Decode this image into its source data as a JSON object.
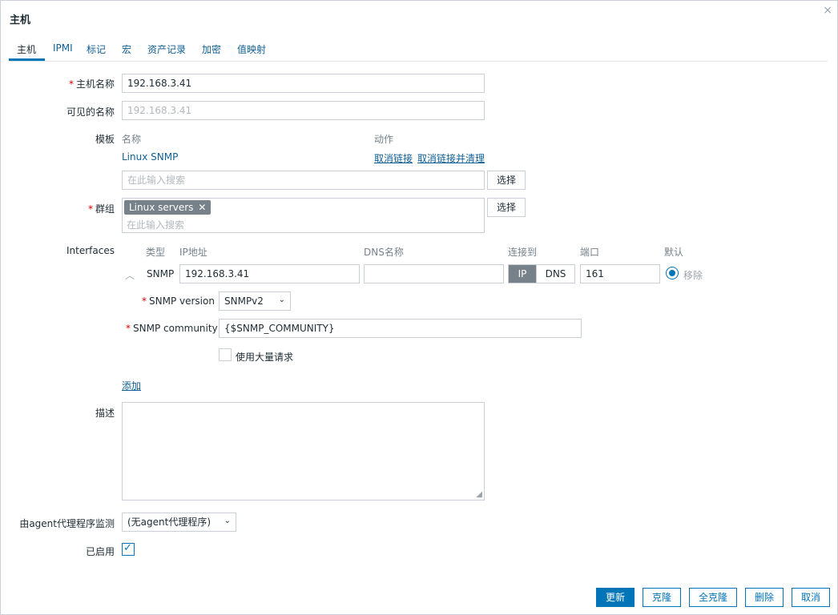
{
  "dialog": {
    "title": "主机",
    "close_glyph": "×"
  },
  "tabs": [
    {
      "label": "主机"
    },
    {
      "label": "IPMI"
    },
    {
      "label": "标记"
    },
    {
      "label": "宏"
    },
    {
      "label": "资产记录"
    },
    {
      "label": "加密"
    },
    {
      "label": "值映射"
    }
  ],
  "form": {
    "required_mark": "*",
    "host_name": {
      "label": "主机名称",
      "value": "192.168.3.41"
    },
    "visible_name": {
      "label": "可见的名称",
      "placeholder": "192.168.3.41"
    },
    "templates": {
      "label": "模板",
      "col_name": "名称",
      "col_action": "动作",
      "items": [
        {
          "name": "Linux SNMP",
          "unlink": "取消链接",
          "unlink_clear": "取消链接并清理"
        }
      ],
      "search_placeholder": "在此输入搜索",
      "select_label": "选择"
    },
    "groups": {
      "label": "群组",
      "tags": [
        {
          "label": "Linux servers",
          "remove": "✕"
        }
      ],
      "search_placeholder": "在此输入搜索",
      "select_label": "选择"
    },
    "interfaces": {
      "label": "Interfaces",
      "headers": {
        "type": "类型",
        "ip": "IP地址",
        "dns": "DNS名称",
        "connect": "连接到",
        "port": "端口",
        "default": "默认"
      },
      "row": {
        "type": "SNMP",
        "ip": "192.168.3.41",
        "dns": "",
        "connect_ip": "IP",
        "connect_dns": "DNS",
        "port": "161",
        "remove": "移除",
        "expand_icon": "︿"
      },
      "snmp_version": {
        "label": "SNMP version",
        "value": "SNMPv2"
      },
      "snmp_community": {
        "label": "SNMP community",
        "value": "{$SNMP_COMMUNITY}"
      },
      "bulk": {
        "label": "使用大量请求",
        "checked": false
      },
      "add_label": "添加"
    },
    "description": {
      "label": "描述",
      "value": ""
    },
    "proxy": {
      "label": "由agent代理程序监测",
      "value": "(无agent代理程序)"
    },
    "enabled": {
      "label": "已启用",
      "checked": true
    }
  },
  "footer": {
    "update": "更新",
    "clone": "克隆",
    "full_clone": "全克隆",
    "delete": "删除",
    "cancel": "取消"
  },
  "colors": {
    "accent": "#0275b8",
    "link": "#0f5f95",
    "required": "#d40000",
    "tag_bg": "#768189"
  }
}
